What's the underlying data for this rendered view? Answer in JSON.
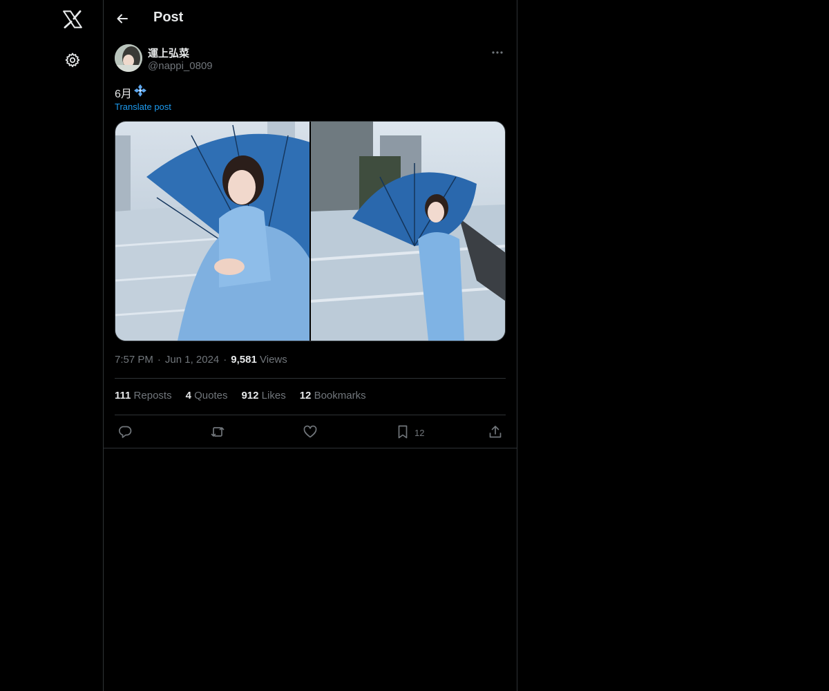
{
  "nav": {
    "logo_icon": "x-logo-icon",
    "settings_icon": "gear-icon"
  },
  "header": {
    "title": "Post"
  },
  "post": {
    "author_name": "運上弘菜",
    "author_handle": "@nappi_0809",
    "text": "6月",
    "text_emoji": "blue-diamond-flower-icon",
    "translate_label": "Translate post",
    "time": "7:57 PM",
    "date": "Jun 1, 2024",
    "views_count": "9,581",
    "views_label": "Views",
    "stats": {
      "reposts_count": "111",
      "reposts_label": "Reposts",
      "quotes_count": "4",
      "quotes_label": "Quotes",
      "likes_count": "912",
      "likes_label": "Likes",
      "bookmarks_count": "12",
      "bookmarks_label": "Bookmarks"
    },
    "actions": {
      "bookmark_count": "12"
    }
  },
  "colors": {
    "background": "#000000",
    "text_primary": "#e7e9ea",
    "text_secondary": "#71767b",
    "link": "#1d9bf0",
    "border": "#2f3336"
  }
}
